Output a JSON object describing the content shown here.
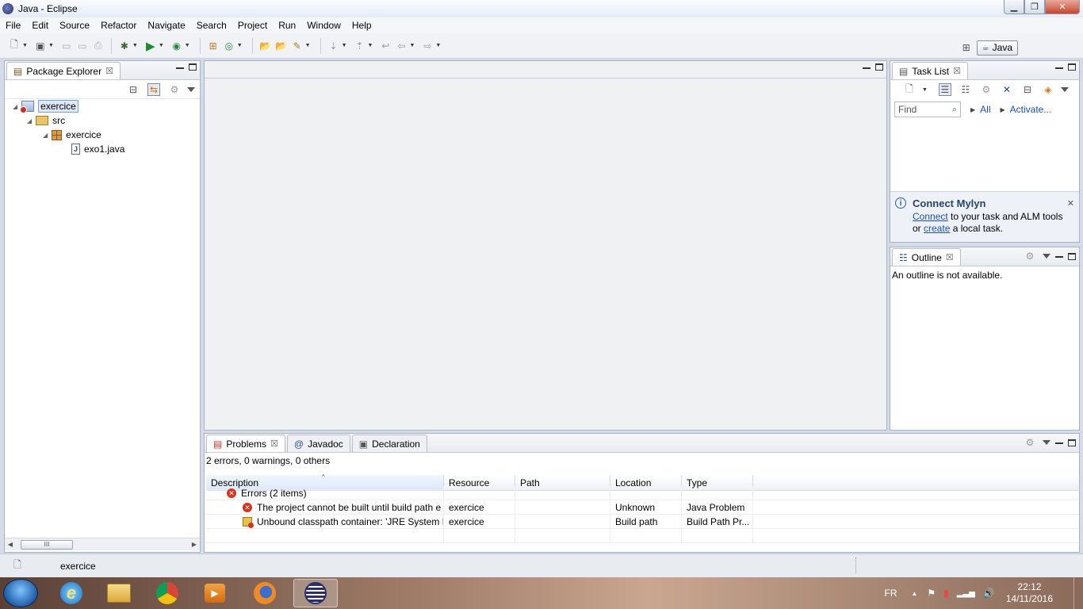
{
  "window": {
    "title": "Java - Eclipse"
  },
  "menu": [
    "File",
    "Edit",
    "Source",
    "Refactor",
    "Navigate",
    "Search",
    "Project",
    "Run",
    "Window",
    "Help"
  ],
  "perspective": {
    "label": "Java"
  },
  "package_explorer": {
    "tab_label": "Package Explorer",
    "tree": {
      "project": "exercice",
      "src": "src",
      "package": "exercice",
      "file": "exo1.java"
    },
    "scroll_label": "III"
  },
  "task_list": {
    "tab_label": "Task List",
    "find_placeholder": "Find",
    "all_label": "All",
    "activate_label": "Activate..."
  },
  "mylyn": {
    "title": "Connect Mylyn",
    "connect_link": "Connect",
    "line1_rest": " to your task and ALM tools",
    "line2_prefix": "or ",
    "create_link": "create",
    "line2_rest": " a local task."
  },
  "outline": {
    "tab_label": "Outline",
    "message": "An outline is not available."
  },
  "bottom_tabs": {
    "problems": "Problems",
    "javadoc": "Javadoc",
    "declaration": "Declaration"
  },
  "problems": {
    "summary": "2 errors, 0 warnings, 0 others",
    "columns": [
      "Description",
      "Resource",
      "Path",
      "Location",
      "Type"
    ],
    "group_label": "Errors (2 items)",
    "rows": [
      {
        "description": "The project cannot be built until build path e",
        "resource": "exercice",
        "path": "",
        "location": "Unknown",
        "type": "Java Problem"
      },
      {
        "description": "Unbound classpath container: 'JRE System Lit",
        "resource": "exercice",
        "path": "",
        "location": "Build path",
        "type": "Build Path Pr..."
      }
    ]
  },
  "status": {
    "selection": "exercice"
  },
  "taskbar": {
    "language": "FR",
    "time": "22:12",
    "date": "14/11/2016"
  }
}
